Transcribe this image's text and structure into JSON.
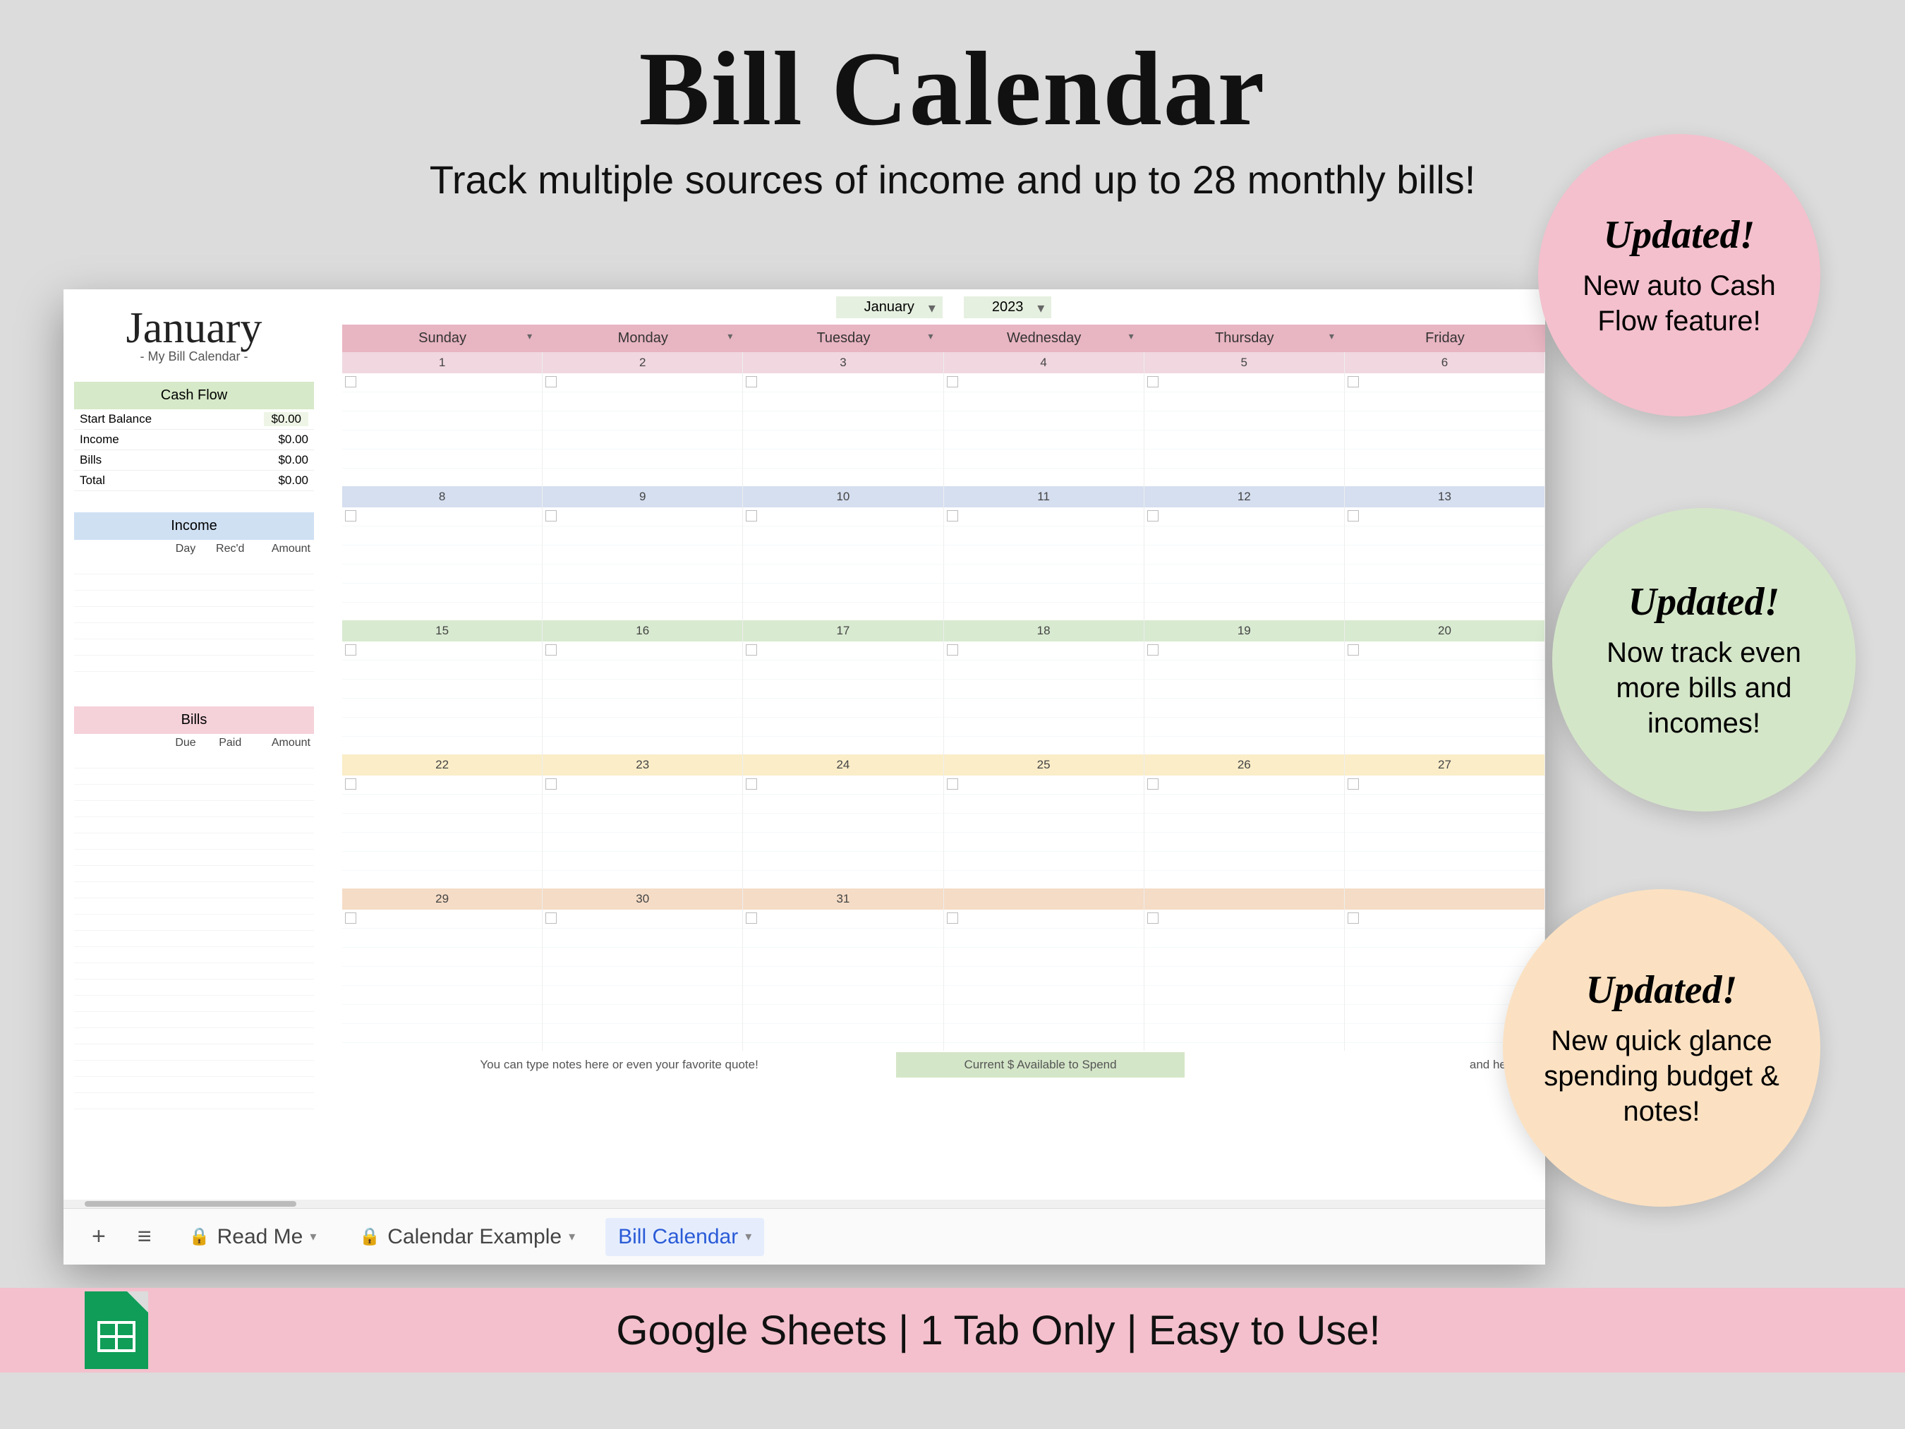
{
  "hero": {
    "title": "Bill Calendar",
    "subtitle": "Track multiple sources of income and up to 28 monthly bills!"
  },
  "sidebar": {
    "month": "January",
    "subtitle": "- My Bill Calendar -",
    "cashflow": {
      "title": "Cash Flow",
      "rows": [
        {
          "label": "Start Balance",
          "value": "$0.00",
          "input": true
        },
        {
          "label": "Income",
          "value": "$0.00"
        },
        {
          "label": "Bills",
          "value": "$0.00"
        },
        {
          "label": "Total",
          "value": "$0.00"
        }
      ]
    },
    "income": {
      "title": "Income",
      "cols": [
        "",
        "Day",
        "Rec'd",
        "Amount"
      ]
    },
    "bills": {
      "title": "Bills",
      "cols": [
        "",
        "Due",
        "Paid",
        "Amount"
      ]
    }
  },
  "calendar": {
    "monthSelect": "January",
    "yearSelect": "2023",
    "days": [
      "Sunday",
      "Monday",
      "Tuesday",
      "Wednesday",
      "Thursday",
      "Friday"
    ],
    "weeks": [
      [
        1,
        2,
        3,
        4,
        5,
        6
      ],
      [
        8,
        9,
        10,
        11,
        12,
        13
      ],
      [
        15,
        16,
        17,
        18,
        19,
        20
      ],
      [
        22,
        23,
        24,
        25,
        26,
        27
      ],
      [
        29,
        30,
        31,
        "",
        "",
        ""
      ]
    ],
    "noteHint": "You can type notes here or even your favorite quote!",
    "avail": "Current $ Available to Spend",
    "noteRight": "and here"
  },
  "tabs": {
    "items": [
      {
        "label": "Read Me",
        "locked": true
      },
      {
        "label": "Calendar Example",
        "locked": true
      },
      {
        "label": "Bill Calendar",
        "active": true
      }
    ]
  },
  "badges": [
    {
      "title": "Updated!",
      "text": "New auto Cash Flow feature!"
    },
    {
      "title": "Updated!",
      "text": "Now track even more bills and incomes!"
    },
    {
      "title": "Updated!",
      "text": "New quick glance spending budget & notes!"
    }
  ],
  "bottom": "Google Sheets | 1 Tab Only | Easy to Use!"
}
